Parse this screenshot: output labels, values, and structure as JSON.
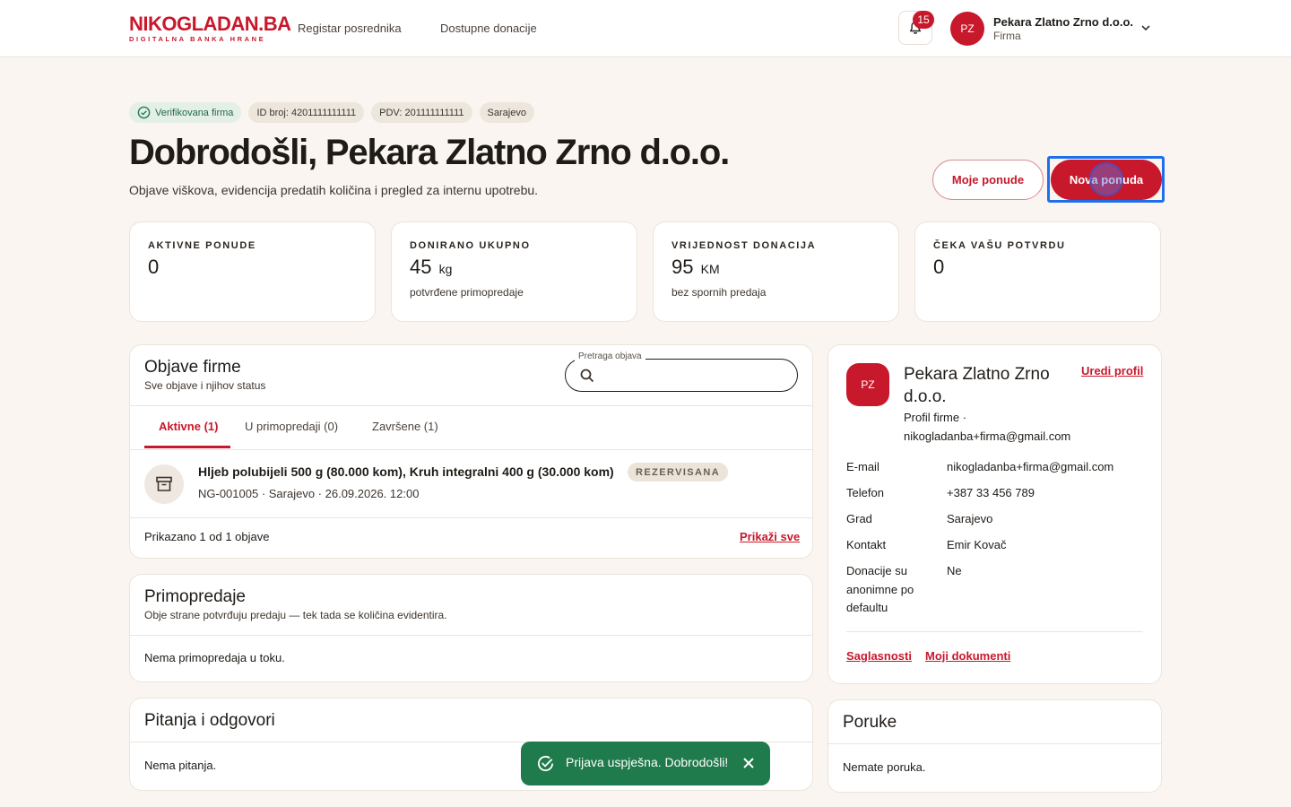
{
  "brand": {
    "logo_main_a": "NIKO",
    "logo_main_b": "GLADAN.BA",
    "logo_sub": "DIGITALNA BANKA HRANE"
  },
  "nav": {
    "links": [
      "Registar posrednika",
      "Dostupne donacije"
    ]
  },
  "notifications": {
    "count": "15",
    "icon": "bell-icon"
  },
  "user": {
    "initials": "PZ",
    "name": "Pekara Zlatno Zrno d.o.o.",
    "role": "Firma"
  },
  "hero": {
    "chips": [
      "Verifikovana firma",
      "ID broj: 4201111111111",
      "PDV: 201111111111",
      "Sarajevo"
    ],
    "title": "Dobrodošli, Pekara Zlatno Zrno d.o.o.",
    "subtitle": "Objave viškova, evidencija predatih količina i pregled za internu upotrebu.",
    "btn_my_offers": "Moje ponude",
    "btn_new_offer": "Nova ponuda"
  },
  "stats": [
    {
      "label": "AKTIVNE PONUDE",
      "value": "0",
      "unit": "",
      "note": ""
    },
    {
      "label": "DONIRANO UKUPNO",
      "value": "45",
      "unit": "kg",
      "note": "potvrđene primopredaje"
    },
    {
      "label": "VRIJEDNOST DONACIJA",
      "value": "95",
      "unit": "KM",
      "note": "bez spornih predaja"
    },
    {
      "label": "ČEKA VAŠU POTVRDU",
      "value": "0",
      "unit": "",
      "note": ""
    }
  ],
  "posts": {
    "title": "Objave firme",
    "subtitle": "Sve objave i njihov status",
    "search_label": "Pretraga objava",
    "search_value": "",
    "tabs": [
      "Aktivne (1)",
      "U primopredaji (0)",
      "Završene (1)"
    ],
    "active_tab": 0,
    "item": {
      "title": "Hljeb polubijeli 500 g (80.000 kom), Kruh integralni 400 g (30.000 kom)",
      "badge": "REZERVISANA",
      "meta": "NG-001005 · Sarajevo · 26.09.2026. 12:00"
    },
    "footer": "Prikazano 1 od 1 objave",
    "show_all": "Prikaži sve"
  },
  "handovers": {
    "title": "Primopredaje",
    "subtitle": "Obje strane potvrđuju predaju — tek tada se količina evidentira.",
    "empty": "Nema primopredaja u toku."
  },
  "qa": {
    "title": "Pitanja i odgovori",
    "empty": "Nema pitanja."
  },
  "profile": {
    "initials": "PZ",
    "name": "Pekara Zlatno Zrno d.o.o.",
    "edit": "Uredi profil",
    "desc": "Profil firme · nikogladanba+firma@gmail.com",
    "rows": [
      {
        "key": "E-mail",
        "value": "nikogladanba+firma@gmail.com"
      },
      {
        "key": "Telefon",
        "value": "+387 33 456 789"
      },
      {
        "key": "Grad",
        "value": "Sarajevo"
      },
      {
        "key": "Kontakt",
        "value": "Emir Kovač"
      },
      {
        "key": "Donacije su anonimne po defaultu",
        "value": "Ne"
      }
    ],
    "consents": "Saglasnosti",
    "documents": "Moji dokumenti"
  },
  "messages": {
    "title": "Poruke",
    "empty": "Nemate poruka."
  },
  "toast": {
    "text": "Prijava uspješna. Dobrodošli!"
  },
  "colors": {
    "accent": "#c8182c",
    "success": "#1f7a4c",
    "background": "#faf5f0"
  }
}
